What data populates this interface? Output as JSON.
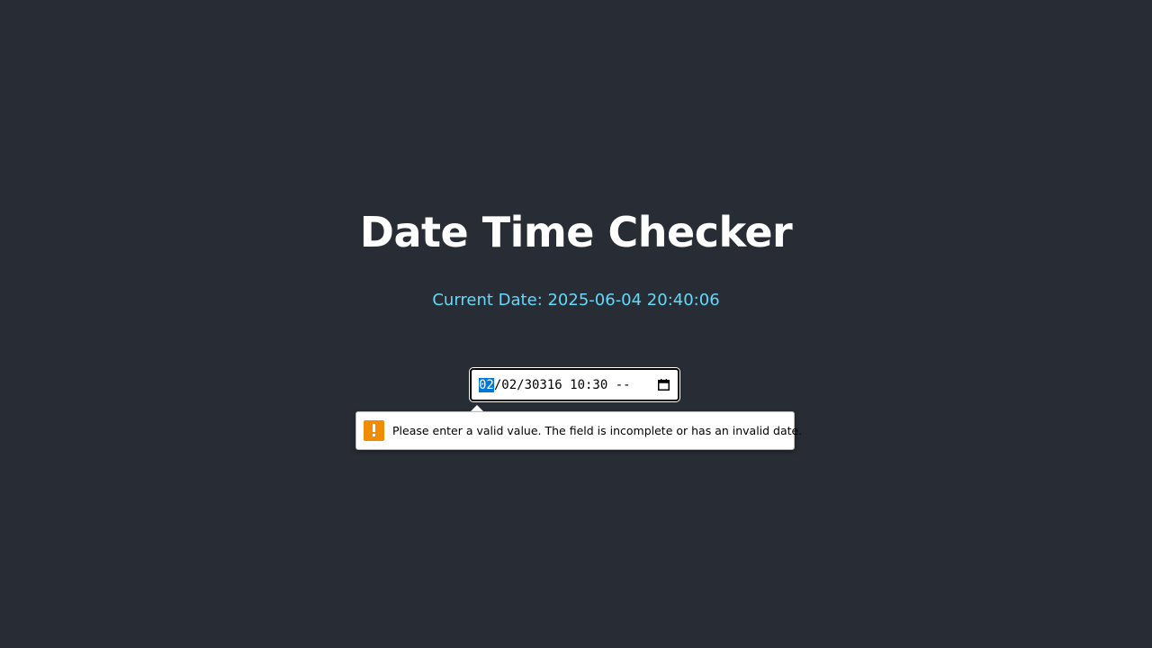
{
  "header": {
    "title": "Date Time Checker"
  },
  "status": {
    "current_date_label": "Current Date: 2025-06-04 20:40:06"
  },
  "datetime_input": {
    "month": "02",
    "rest": "/02/30316 10:30 --",
    "calendar_icon": "calendar-icon"
  },
  "validation": {
    "message": "Please enter a valid value. The field is incomplete or has an invalid date.",
    "icon": "warning-icon",
    "icon_color": "#f08c00"
  },
  "colors": {
    "background": "#282c34",
    "accent": "#61dafb",
    "selection": "#0078d7"
  }
}
